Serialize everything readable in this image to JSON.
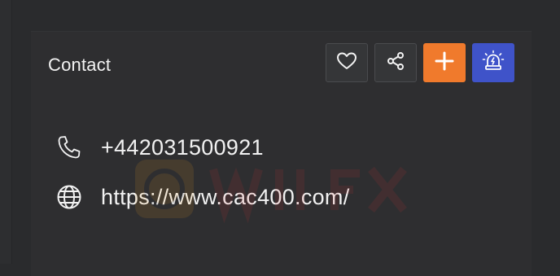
{
  "contact": {
    "title": "Contact",
    "actions": [
      {
        "name": "favorite",
        "icon": "heart-icon"
      },
      {
        "name": "share",
        "icon": "share-icon"
      },
      {
        "name": "add",
        "icon": "plus-icon",
        "color": "#f07a2c"
      },
      {
        "name": "alert",
        "icon": "siren-icon",
        "color": "#3f53c9"
      }
    ],
    "phone": "+442031500921",
    "website": "https://www.cac400.com/"
  }
}
